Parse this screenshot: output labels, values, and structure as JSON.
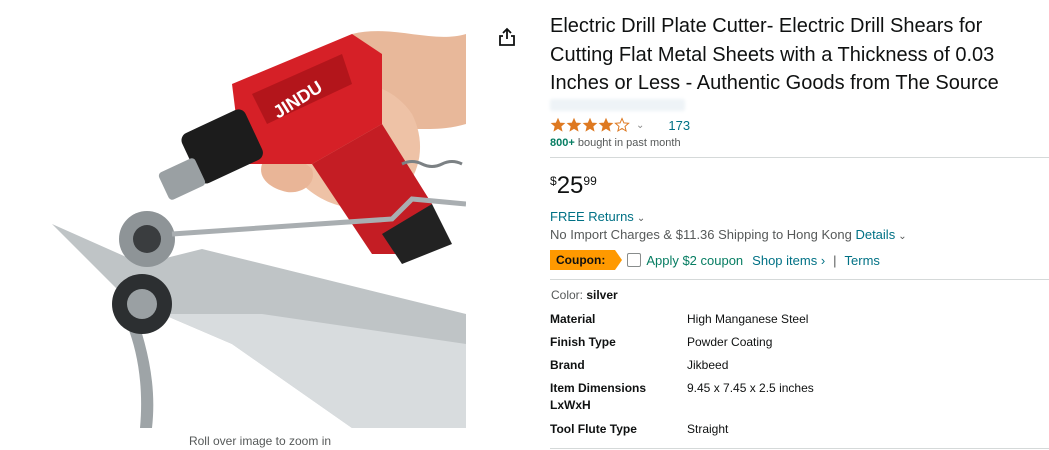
{
  "product": {
    "title": "Electric Drill Plate Cutter- Electric Drill Shears for Cutting Flat Metal Sheets with a Thickness of 0.03 Inches or Less - Authentic Goods from The Source",
    "drill_brand_text": "JINDU",
    "zoom_hint": "Roll over image to zoom in"
  },
  "rating": {
    "stars": 4,
    "count": "173",
    "bought_bold": "800+",
    "bought_rest": " bought in past month"
  },
  "price": {
    "symbol": "$",
    "whole": "25",
    "fraction": "99"
  },
  "delivery": {
    "free_returns": "FREE Returns",
    "shipping_text": "No Import Charges & $11.36 Shipping to Hong Kong ",
    "details_link": "Details"
  },
  "coupon": {
    "badge": "Coupon:",
    "apply_text": "Apply $2 coupon",
    "shop_items": "Shop items ›",
    "separator": "|",
    "terms": "Terms"
  },
  "color": {
    "label": "Color: ",
    "value": "silver"
  },
  "specs": [
    {
      "key": "Material",
      "value": "High Manganese Steel"
    },
    {
      "key": "Finish Type",
      "value": "Powder Coating"
    },
    {
      "key": "Brand",
      "value": "Jikbeed"
    },
    {
      "key": "Item Dimensions LxWxH",
      "value": "9.45 x 7.45 x 2.5 inches"
    },
    {
      "key": "Tool Flute Type",
      "value": "Straight"
    }
  ],
  "icons": {
    "share": "share-icon",
    "star": "star-icon",
    "chevron": "chevron-down-icon"
  },
  "colors": {
    "link": "#007185",
    "star": "#de7921",
    "coupon_badge": "#ff9900",
    "green": "#067d62",
    "drill_red": "#d62027"
  }
}
